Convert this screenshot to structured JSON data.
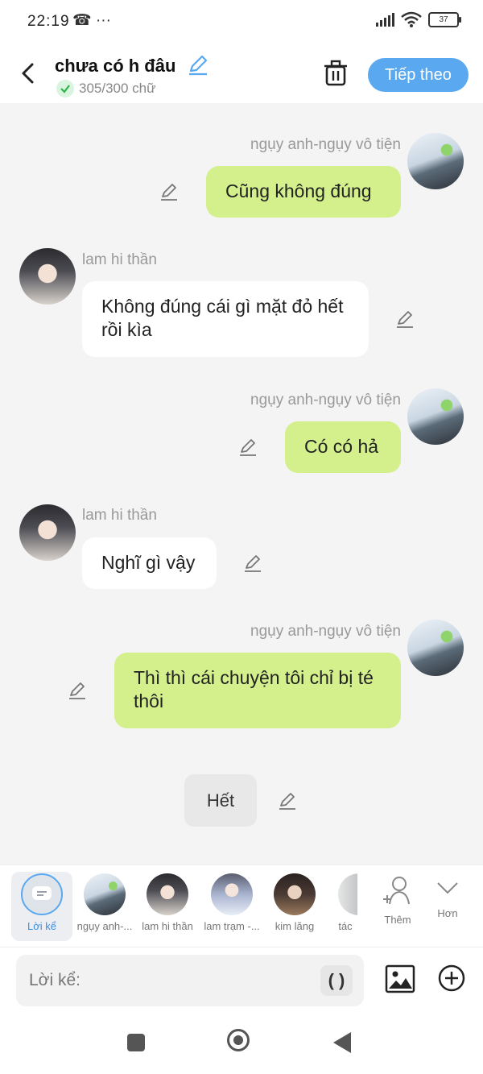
{
  "status_bar": {
    "time": "22:19",
    "extra_icons": "☎ ···",
    "battery": "37"
  },
  "header": {
    "title": "chưa có h đâu",
    "word_count": "305/300 chữ",
    "next_button": "Tiếp theo"
  },
  "messages": [
    {
      "sender": "ngụy anh-ngụy vô tiện",
      "text": "Cũng không đúng",
      "side": "right"
    },
    {
      "sender": "lam hi thần",
      "text": "Không đúng cái gì mặt đỏ hết rồi kìa",
      "side": "left"
    },
    {
      "sender": "ngụy anh-ngụy vô tiện",
      "text": "Có có hả",
      "side": "right"
    },
    {
      "sender": "lam hi thần",
      "text": "Nghĩ gì vậy",
      "side": "left"
    },
    {
      "sender": "ngụy anh-ngụy vô tiện",
      "text": "Thì thì cái chuyện tôi chỉ bị té thôi",
      "side": "right"
    }
  ],
  "end_marker": "Hết",
  "characters": [
    {
      "name": "Lời kể",
      "selected": true
    },
    {
      "name": "ngụy anh-..."
    },
    {
      "name": "lam hi thần"
    },
    {
      "name": "lam trạm -..."
    },
    {
      "name": "kim lăng"
    },
    {
      "name": "tác"
    },
    {
      "name": "Thêm"
    },
    {
      "name": "Hơn"
    }
  ],
  "input": {
    "placeholder": "Lời kể:",
    "paren_button": "( )"
  },
  "colors": {
    "accent": "#5aa9f0",
    "my_bubble": "#d4f08d",
    "their_bubble": "#ffffff",
    "background": "#f4f4f4"
  }
}
